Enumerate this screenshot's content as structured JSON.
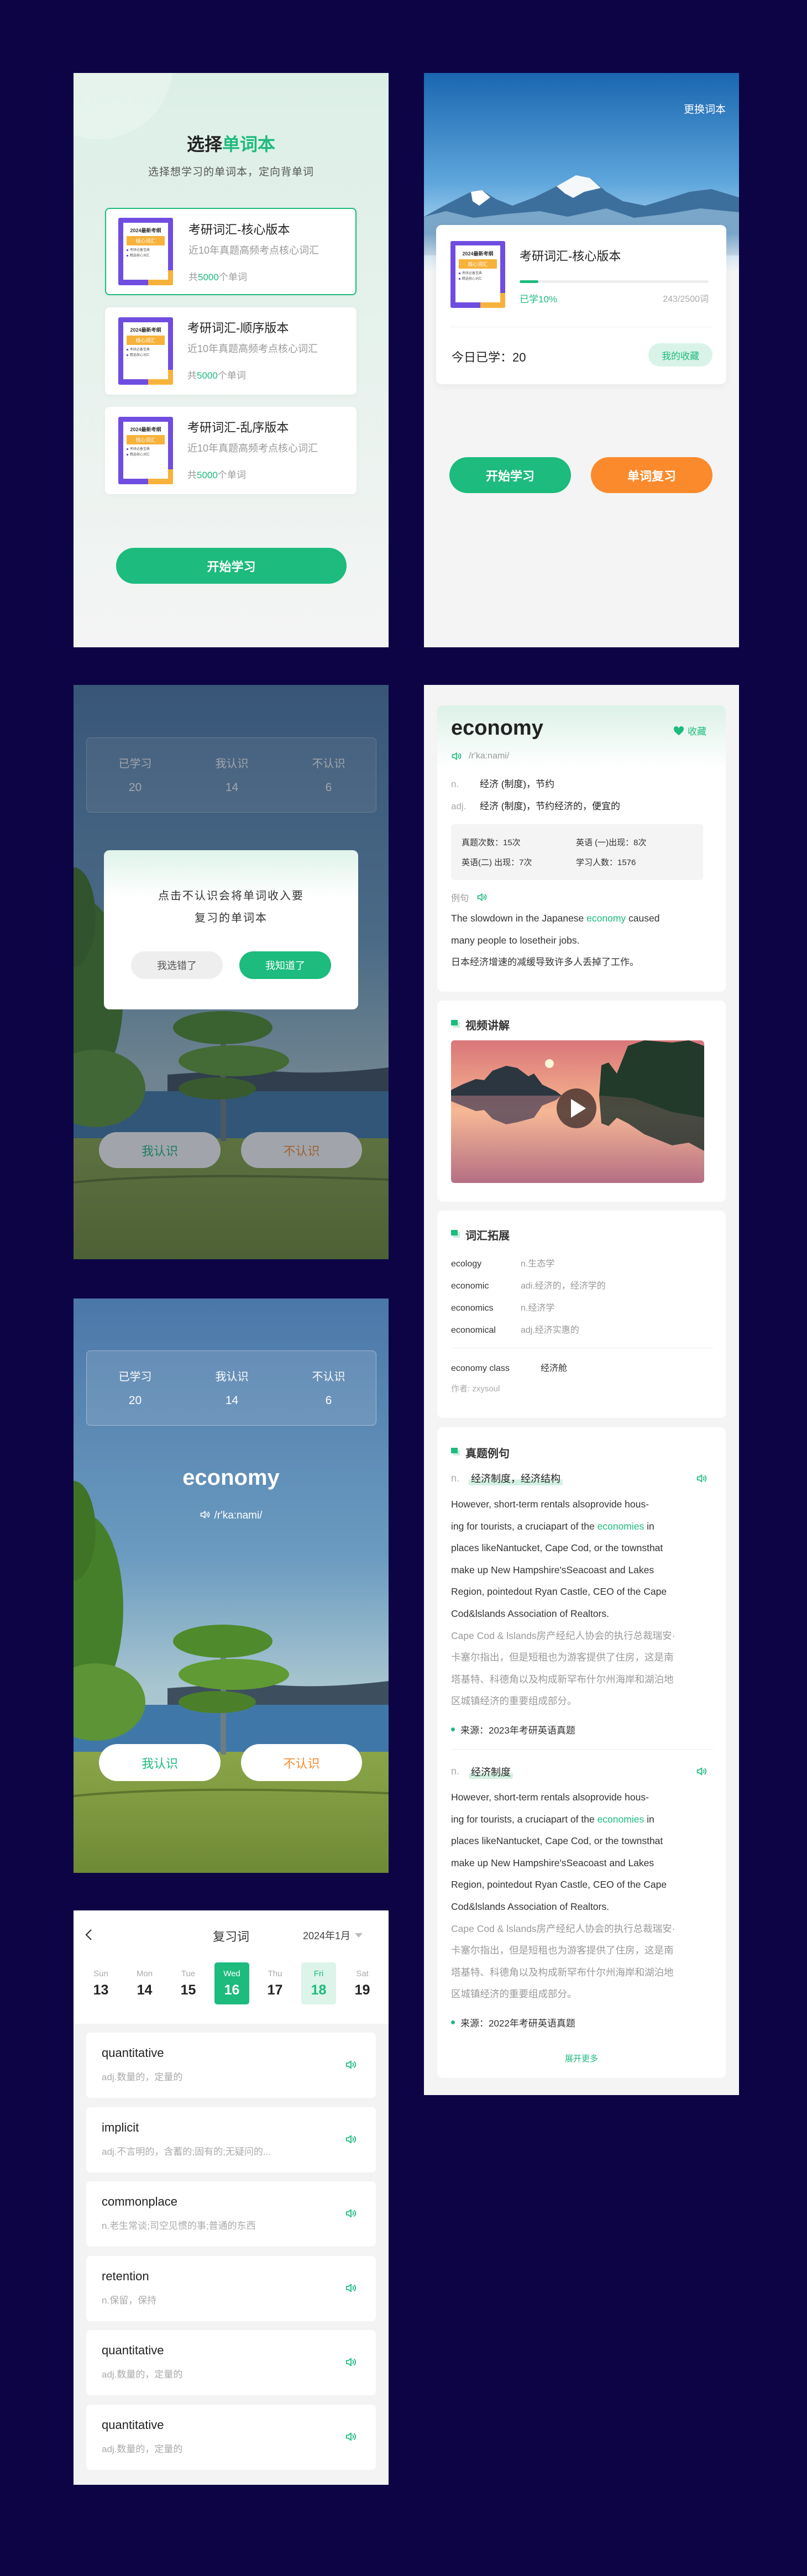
{
  "colors": {
    "primary": "#1dbb7d",
    "accent_orange": "#fb8a2c",
    "backdrop": "#0d0445",
    "cover_purple": "#6f4de0",
    "cover_orange": "#f7b23b"
  },
  "book_cover": {
    "year_line": "2024最新考纲",
    "banner": "核心词汇",
    "bullets": [
      "考研必备宝典",
      "精选核心词汇"
    ]
  },
  "select_book": {
    "title_plain": "选择",
    "title_accent": "单词本",
    "subtitle": "选择想学习的单词本，定向背单词",
    "books": [
      {
        "title": "考研词汇-核心版本",
        "desc": "近10年真题高频考点核心词汇",
        "count_prefix": "共",
        "count": "5000",
        "count_suffix": "个单词",
        "selected": true
      },
      {
        "title": "考研词汇-顺序版本",
        "desc": "近10年真题高频考点核心词汇",
        "count_prefix": "共",
        "count": "5000",
        "count_suffix": "个单词",
        "selected": false
      },
      {
        "title": "考研词汇-乱序版本",
        "desc": "近10年真题高频考点核心词汇",
        "count_prefix": "共",
        "count": "5000",
        "count_suffix": "个单词",
        "selected": false
      }
    ],
    "start_button": "开始学习"
  },
  "home": {
    "change_book": "更换词本",
    "book_title": "考研词汇-核心版本",
    "progress_label": "已学10%",
    "progress_percent": 10,
    "progress_count": "243/2500词",
    "today_label": "今日已学：",
    "today_value": "20",
    "favorites": "我的收藏",
    "start_button": "开始学习",
    "review_button": "单词复习"
  },
  "study_stats": {
    "learned_label": "已学习",
    "learned": "20",
    "known_label": "我认识",
    "known": "14",
    "unknown_label": "不认识",
    "unknown": "6"
  },
  "dialog": {
    "line1": "点击不认识会将单词收入要",
    "line2": "复习的单词本",
    "cancel": "我选错了",
    "confirm": "我知道了"
  },
  "card_buttons": {
    "know": "我认识",
    "dont_know": "不认识"
  },
  "flashcard": {
    "word": "economy",
    "phonetic": "/r'ka:nami/"
  },
  "detail": {
    "word": "economy",
    "favorite": "收藏",
    "phonetic": "/r'ka:nami/",
    "definitions": [
      {
        "pos": "n.",
        "text": "经济 (制度)，节约"
      },
      {
        "pos": "adj.",
        "text": "经济 (制度)，节约经济的，便宜的"
      }
    ],
    "stats": {
      "exam_count": "真题次数：15次",
      "english1": "英语 (一)出现：8次",
      "english2": "英语(二) 出现：7次",
      "learners": "学习人数：1576"
    },
    "example_label": "例句",
    "example_lines": [
      "The slowdown in the Japanese economy caused",
      "many people to losetheir jobs."
    ],
    "example_highlight": "economy",
    "example_translation": "日本经济增速的减缓导致许多人丢掉了工作。",
    "video_title": "视频讲解",
    "vocab_title": "词汇拓展",
    "vocab": [
      {
        "word": "ecology",
        "meaning": "n.生态学"
      },
      {
        "word": "economic",
        "meaning": "adi.经济的，经济学的"
      },
      {
        "word": "economics",
        "meaning": "n.经济学"
      },
      {
        "word": "economical",
        "meaning": "adj.经济实惠的"
      }
    ],
    "phrase": {
      "word": "economy class",
      "meaning": "经济舱"
    },
    "author": "作者: zxysoul",
    "exam_title": "真题例句",
    "exam_examples": [
      {
        "pos": "n.",
        "sense": "经济制度，经济结构",
        "english_lines": [
          "However, short-term rentals alsoprovide hous-",
          "ing for tourists, a cruciapart of the economies in",
          "places likeNantucket, Cape Cod, or the townsthat",
          "make up New Hampshire'sSeacoast and Lakes",
          "Region, pointedout Ryan Castle, CEO of the Cape",
          "Cod&lslands Association of Realtors."
        ],
        "chinese_lines": [
          "Cape Cod & lslands房产经纪人协会的执行总裁瑞安·",
          "卡塞尔指出，但是短租也为游客提供了住房，这是南",
          "塔基特、科德角以及构成新罕布什尔州海岸和湖泊地",
          "区城镇经济的重要组成部分。"
        ],
        "source": "来源：2023年考研英语真题"
      },
      {
        "pos": "n.",
        "sense": "经济制度",
        "english_lines": [
          "However, short-term rentals alsoprovide hous-",
          "ing for tourists, a cruciapart of the economies in",
          "places likeNantucket, Cape Cod, or the townsthat",
          "make up New Hampshire'sSeacoast and Lakes",
          "Region, pointedout Ryan Castle, CEO of the Cape",
          "Cod&lslands Association of Realtors."
        ],
        "chinese_lines": [
          "Cape Cod & lslands房产经纪人协会的执行总裁瑞安·",
          "卡塞尔指出，但是短租也为游客提供了住房，这是南",
          "塔基特、科德角以及构成新罕布什尔州海岸和湖泊地",
          "区城镇经济的重要组成部分。"
        ],
        "source": "来源：2022年考研英语真题"
      }
    ],
    "exam_highlight": "economies",
    "expand_more": "展开更多"
  },
  "review": {
    "title": "复习词",
    "month": "2024年1月",
    "days": [
      {
        "label": "Sun",
        "num": "13",
        "state": "normal"
      },
      {
        "label": "Mon",
        "num": "14",
        "state": "normal"
      },
      {
        "label": "Tue",
        "num": "15",
        "state": "normal"
      },
      {
        "label": "Wed",
        "num": "16",
        "state": "selected"
      },
      {
        "label": "Thu",
        "num": "17",
        "state": "normal"
      },
      {
        "label": "Fri",
        "num": "18",
        "state": "highlight"
      },
      {
        "label": "Sat",
        "num": "19",
        "state": "normal"
      }
    ],
    "words": [
      {
        "word": "quantitative",
        "meaning": "adj.数量的，定量的"
      },
      {
        "word": "implicit",
        "meaning": "adj.不言明的，含蓄的;固有的;无疑问的..."
      },
      {
        "word": "commonplace",
        "meaning": "n.老生常谈;司空见惯的事;普通的东西"
      },
      {
        "word": "retention",
        "meaning": "n.保留，保持"
      },
      {
        "word": "quantitative",
        "meaning": "adj.数量的，定量的"
      },
      {
        "word": "quantitative",
        "meaning": "adj.数量的，定量的"
      }
    ]
  }
}
